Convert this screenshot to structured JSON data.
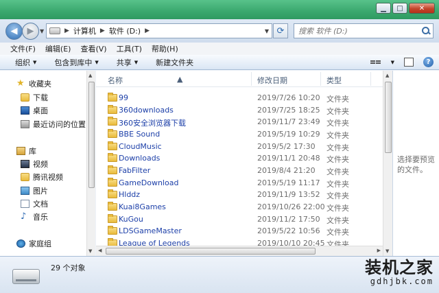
{
  "address_bar": {
    "crumbs": [
      "计算机",
      "软件 (D:)"
    ],
    "search_placeholder": "搜索 软件 (D:)"
  },
  "menu": [
    "文件(F)",
    "编辑(E)",
    "查看(V)",
    "工具(T)",
    "帮助(H)"
  ],
  "toolbar": {
    "organize": "组织",
    "include_library": "包含到库中",
    "share": "共享",
    "new_folder": "新建文件夹"
  },
  "nav_pane": {
    "favorites": "收藏夹",
    "downloads": "下载",
    "desktop": "桌面",
    "recent": "最近访问的位置",
    "libraries": "库",
    "videos": "视频",
    "tencent_video": "腾讯视频",
    "pictures": "图片",
    "documents": "文档",
    "music": "音乐",
    "homegroup": "家庭组"
  },
  "columns": {
    "name": "名称",
    "date": "修改日期",
    "type": "类型"
  },
  "files": [
    {
      "name": "99",
      "date": "2019/7/26 10:20",
      "type": "文件夹"
    },
    {
      "name": "360downloads",
      "date": "2019/7/25 18:25",
      "type": "文件夹"
    },
    {
      "name": "360安全浏览器下载",
      "date": "2019/11/7 23:49",
      "type": "文件夹"
    },
    {
      "name": "BBE Sound",
      "date": "2019/5/19 10:29",
      "type": "文件夹"
    },
    {
      "name": "CloudMusic",
      "date": "2019/5/2 17:30",
      "type": "文件夹"
    },
    {
      "name": "Downloads",
      "date": "2019/11/1 20:48",
      "type": "文件夹"
    },
    {
      "name": "FabFilter",
      "date": "2019/8/4 21:20",
      "type": "文件夹"
    },
    {
      "name": "GameDownload",
      "date": "2019/5/19 11:17",
      "type": "文件夹"
    },
    {
      "name": "Hlddz",
      "date": "2019/11/9 13:52",
      "type": "文件夹"
    },
    {
      "name": "Kuai8Games",
      "date": "2019/10/26 22:00",
      "type": "文件夹"
    },
    {
      "name": "KuGou",
      "date": "2019/11/2 17:50",
      "type": "文件夹"
    },
    {
      "name": "LDSGameMaster",
      "date": "2019/5/22 10:56",
      "type": "文件夹"
    },
    {
      "name": "League of Legends",
      "date": "2019/10/10 20:45",
      "type": "文件夹"
    }
  ],
  "preview_text": "选择要预览\n的文件。",
  "status": {
    "count": "29 个对象"
  },
  "watermark": {
    "cn": "装机之家",
    "url": "gdhjbk.com"
  }
}
